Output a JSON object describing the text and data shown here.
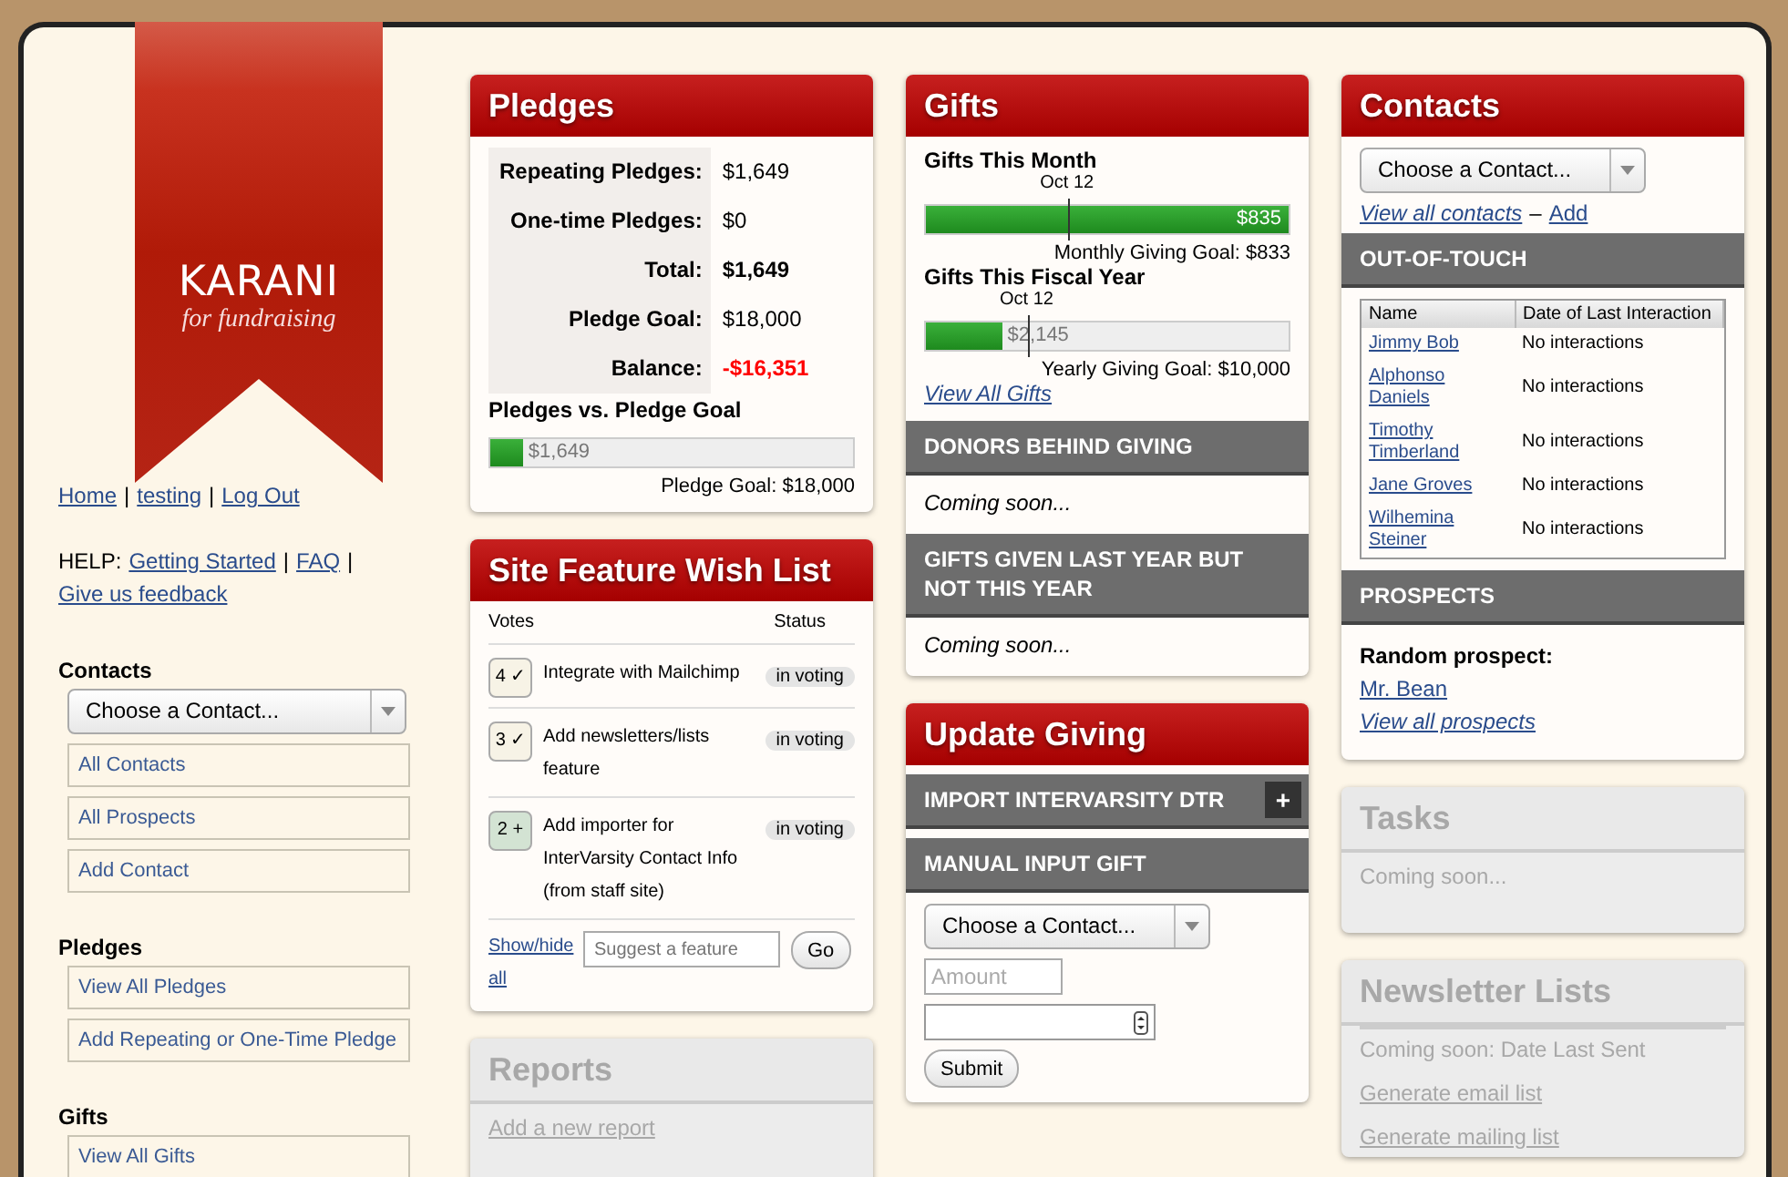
{
  "logo": {
    "name": "KARANI",
    "tagline": "for fundraising"
  },
  "sidebar": {
    "user_line": [
      {
        "kind": "link",
        "text": "Home"
      },
      {
        "kind": "text",
        "text": "|"
      },
      {
        "kind": "link",
        "text": "testing"
      },
      {
        "kind": "text",
        "text": "|"
      },
      {
        "kind": "link",
        "text": "Log Out"
      }
    ],
    "help_line": [
      {
        "kind": "text",
        "text": "HELP:"
      },
      {
        "kind": "link",
        "text": "Getting Started"
      },
      {
        "kind": "text",
        "text": "|"
      },
      {
        "kind": "link",
        "text": "FAQ"
      },
      {
        "kind": "text",
        "text": "|"
      },
      {
        "kind": "link",
        "text": "Give us feedback"
      }
    ],
    "sections": [
      {
        "title": "Contacts",
        "select": "Choose a Contact...",
        "items": [
          "All Contacts",
          "All Prospects",
          "Add Contact"
        ]
      },
      {
        "title": "Pledges",
        "items": [
          "View All Pledges",
          "Add Repeating or One-Time Pledge"
        ]
      },
      {
        "title": "Gifts",
        "items": [
          "View All Gifts"
        ]
      }
    ]
  },
  "pledges": {
    "title": "Pledges",
    "disabled": false,
    "rows": [
      {
        "label": "Repeating Pledges:",
        "value": "$1,649",
        "kind": "plain"
      },
      {
        "label": "One-time Pledges:",
        "value": "$0",
        "kind": "plain"
      },
      {
        "label": "Total:",
        "value": "$1,649",
        "kind": "total"
      },
      {
        "label": "Pledge Goal:",
        "value": "$18,000",
        "kind": "plain"
      },
      {
        "label": "Balance:",
        "value": "-$16,351",
        "kind": "negative"
      }
    ],
    "progress": {
      "title": "Pledges vs. Pledge Goal",
      "level": 0.09,
      "reading": "$1,649",
      "goal": "Pledge Goal: $18,000"
    }
  },
  "wish_list": {
    "title": "Site Feature Wish List",
    "disabled": false,
    "columns": [
      "Votes",
      "Status"
    ],
    "features": [
      {
        "votes": "4 ✓",
        "voted": true,
        "text": "Integrate with Mailchimp",
        "status": "in voting"
      },
      {
        "votes": "3 ✓",
        "voted": true,
        "text": "Add newsletters/lists feature",
        "status": "in voting"
      },
      {
        "votes": "2 +",
        "voted": false,
        "text": "Add importer for InterVarsity Contact Info (from staff site)",
        "status": "in voting"
      }
    ],
    "toggle_link": "Show/hide all",
    "suggest_placeholder": "Suggest a feature",
    "go_button": "Go"
  },
  "reports": {
    "title": "Reports",
    "disabled": true,
    "link": "Add a new report"
  },
  "gifts": {
    "title": "Gifts",
    "disabled": false,
    "blocks": [
      {
        "title": "Gifts This Month",
        "marker": {
          "label": "Oct 12",
          "level": 0.39
        },
        "level": 1,
        "reading": "$835",
        "goal": "Monthly Giving Goal: $833"
      },
      {
        "title": "Gifts This Fiscal Year",
        "marker": {
          "label": "Oct 12",
          "level": 0.28
        },
        "level": 0.21,
        "reading": "$2,145",
        "goal": "Yearly Giving Goal: $10,000"
      }
    ],
    "link": "View All Gifts",
    "sections": [
      {
        "title": "DONORS BEHIND GIVING",
        "text": "Coming soon..."
      },
      {
        "title": "GIFTS GIVEN LAST YEAR BUT NOT THIS YEAR",
        "text": "Coming soon..."
      }
    ]
  },
  "update_giving": {
    "title": "Update Giving",
    "disabled": false,
    "import_title": "IMPORT INTERVARSITY DTR",
    "import_button": "+",
    "manual_title": "MANUAL INPUT GIFT",
    "select": "Choose a Contact...",
    "amount_placeholder": "Amount",
    "submit": "Submit"
  },
  "contacts": {
    "title": "Contacts",
    "disabled": false,
    "select": "Choose a Contact...",
    "links": [
      {
        "kind": "link",
        "text": "View all contacts"
      },
      {
        "kind": "text",
        "text": "–"
      },
      {
        "kind": "plainlink",
        "text": "Add"
      }
    ],
    "out_of_touch": {
      "title": "OUT-OF-TOUCH",
      "columns": [
        "Name",
        "Date of Last Interaction"
      ],
      "rows": [
        [
          "Jimmy Bob",
          "No interactions"
        ],
        [
          "Alphonso Daniels",
          "No interactions"
        ],
        [
          "Timothy Timberland",
          "No interactions"
        ],
        [
          "Jane Groves",
          "No interactions"
        ],
        [
          "Wilhemina Steiner",
          "No interactions"
        ]
      ]
    },
    "prospects": {
      "title": "PROSPECTS",
      "label": "Random prospect:",
      "prospect": "Mr. Bean",
      "link": "View all prospects"
    }
  },
  "tasks": {
    "title": "Tasks",
    "disabled": true,
    "text": "Coming soon..."
  },
  "newsletter_lists": {
    "title": "Newsletter Lists",
    "disabled": true,
    "text": "Coming soon: Date Last Sent",
    "links": [
      "Generate email list",
      "Generate mailing list"
    ]
  }
}
